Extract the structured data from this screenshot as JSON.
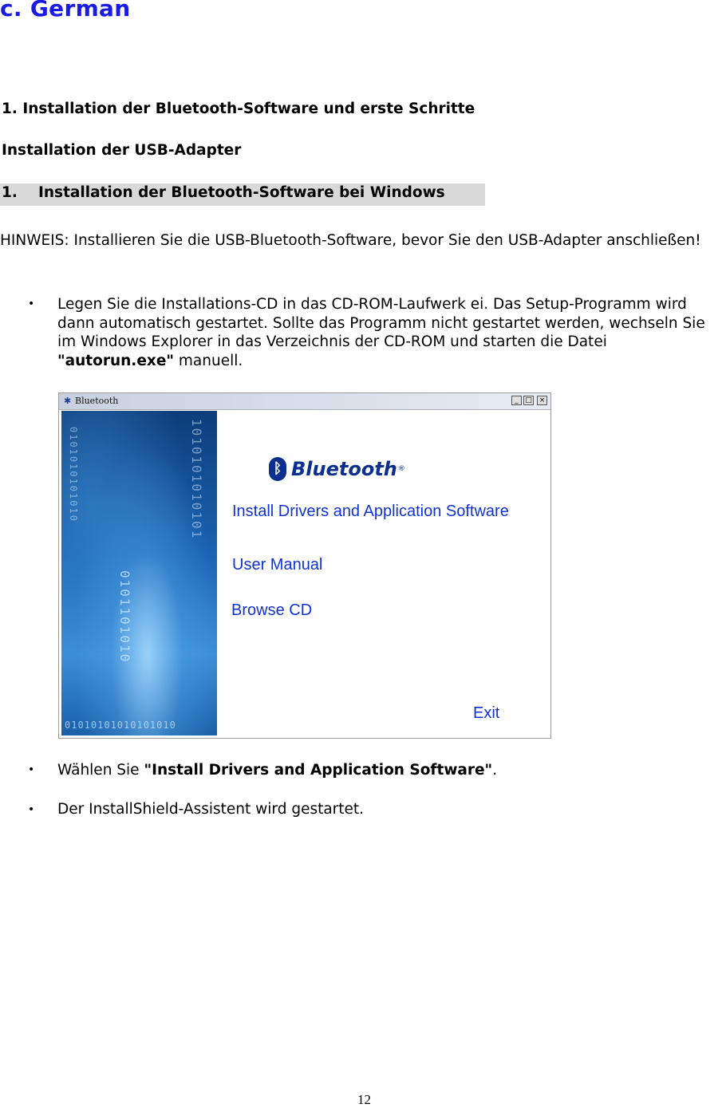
{
  "section": {
    "title": "c. German"
  },
  "headings": {
    "main": "1. Installation der Bluetooth-Software und erste Schritte",
    "sub": "Installation der USB-Adapter",
    "step_number": "1.",
    "step_title": "Installation der Bluetooth-Software bei Windows"
  },
  "note": "HINWEIS: Installieren Sie die USB-Bluetooth-Software, bevor Sie den USB-Adapter anschließen!",
  "bullets": {
    "b1_text": "Legen Sie die Installations-CD in das CD-ROM-Laufwerk ei. Das Setup-Programm wird dann automatisch gestartet. Sollte das Programm nicht gestartet werden, wechseln Sie im Windows Explorer in das Verzeichnis der CD-ROM und starten die Datei ",
    "b1_bold": "\"autorun.exe\"",
    "b1_end": " manuell.",
    "b2_text": "Wählen Sie ",
    "b2_bold": "\"Install Drivers and Application Software\"",
    "b2_end": ".",
    "b3_text": "Der InstallShield-Assistent wird gestartet.",
    "bullet_glyph": "•"
  },
  "screenshot": {
    "window_title": "Bluetooth",
    "title_icon": "bluetooth-icon",
    "btn_minimize": "_",
    "btn_maximize": "□",
    "btn_close": "×",
    "logo_mark": "ᛒ",
    "logo_text": "Bluetooth",
    "logo_reg": "®",
    "menu_install": "Install Drivers and Application Software",
    "menu_manual": "User Manual",
    "menu_browse": "Browse CD",
    "menu_exit": "Exit",
    "binary_col1": "0101010101010",
    "binary_col2": "1010101010101",
    "binary_col3": "0101101010",
    "binary_row": "01010101010101010",
    "link_color": "#1033d8"
  },
  "page_number": "12"
}
